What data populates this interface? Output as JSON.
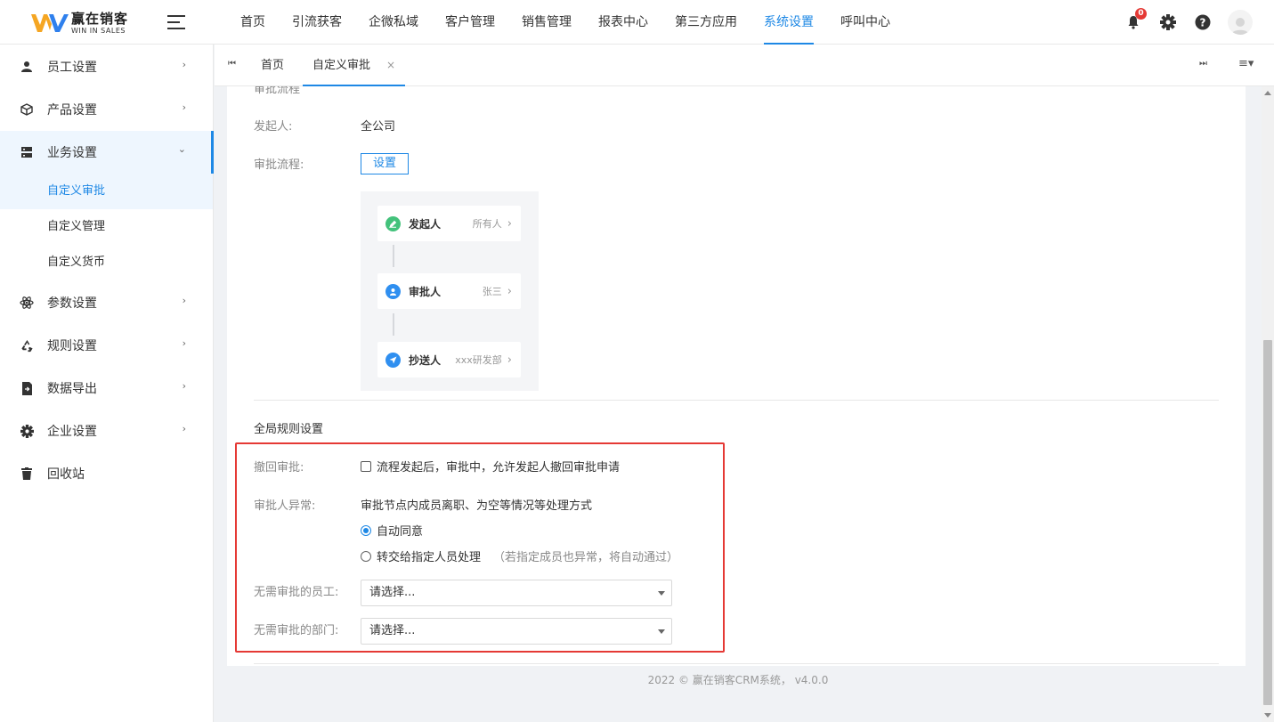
{
  "header": {
    "logo_cn": "赢在销客",
    "logo_en": "WIN IN SALES",
    "notification_count": "0",
    "nav": [
      "首页",
      "引流获客",
      "企微私域",
      "客户管理",
      "销售管理",
      "报表中心",
      "第三方应用",
      "系统设置",
      "呼叫中心"
    ],
    "active_nav": "系统设置"
  },
  "sidebar": {
    "items": [
      {
        "label": "员工设置",
        "icon": "user-icon"
      },
      {
        "label": "产品设置",
        "icon": "cube-icon"
      },
      {
        "label": "业务设置",
        "icon": "server-icon"
      },
      {
        "label": "参数设置",
        "icon": "atom-icon"
      },
      {
        "label": "规则设置",
        "icon": "recycle-icon"
      },
      {
        "label": "数据导出",
        "icon": "file-export-icon"
      },
      {
        "label": "企业设置",
        "icon": "gear-icon"
      },
      {
        "label": "回收站",
        "icon": "trash-icon"
      }
    ],
    "sub_items": [
      "自定义审批",
      "自定义管理",
      "自定义货币"
    ],
    "active_sub": "自定义审批"
  },
  "tabs": {
    "items": [
      "首页",
      "自定义审批"
    ],
    "active": "自定义审批"
  },
  "content": {
    "section_title_top": "审批流程",
    "initiator_label": "发起人:",
    "initiator_value": "全公司",
    "flow_label": "审批流程:",
    "flow_button": "设置",
    "flow_nodes": [
      {
        "name": "发起人",
        "value": "所有人",
        "color": "#43c27b"
      },
      {
        "name": "审批人",
        "value": "张三",
        "color": "#2f8ff0"
      },
      {
        "name": "抄送人",
        "value": "xxx研发部",
        "color": "#2f8ff0"
      }
    ],
    "global_title": "全局规则设置",
    "revoke_label": "撤回审批:",
    "revoke_text": "流程发起后，审批中，允许发起人撤回审批申请",
    "exception_label": "审批人异常:",
    "exception_desc": "审批节点内成员离职、为空等情况等处理方式",
    "radio_auto": "自动同意",
    "radio_transfer": "转交给指定人员处理",
    "radio_transfer_hint": "（若指定成员也异常，将自动通过）",
    "skip_staff_label": "无需审批的员工:",
    "skip_dept_label": "无需审批的部门:",
    "select_placeholder": "请选择..."
  },
  "footer": "2022 © 赢在销客CRM系统， v4.0.0",
  "colors": {
    "accent": "#1e88e5",
    "highlight_box": "#e53935"
  }
}
